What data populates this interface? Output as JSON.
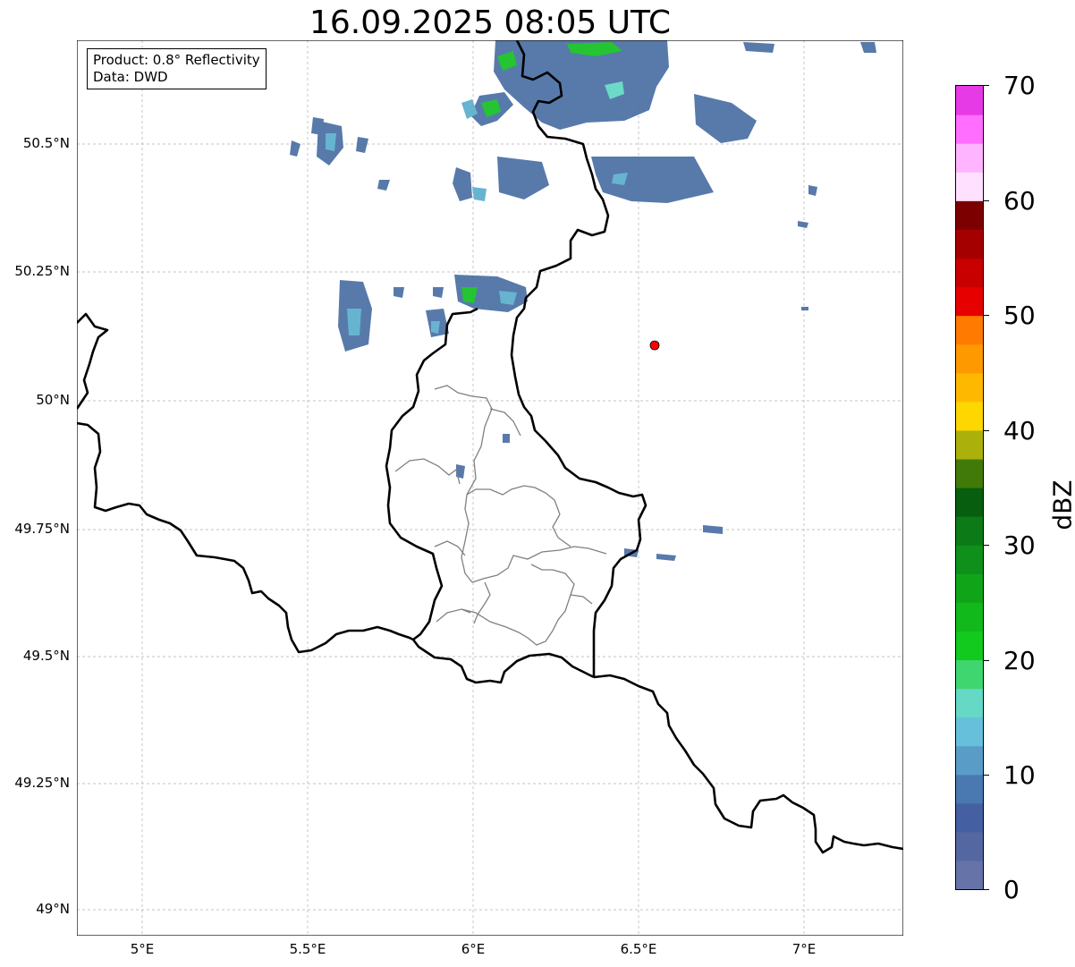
{
  "title": "16.09.2025 08:05 UTC",
  "info_box": {
    "product": "Product: 0.8° Reflectivity",
    "data": "Data: DWD"
  },
  "map": {
    "lon_range": [
      4.8,
      7.3
    ],
    "lat_range": [
      48.95,
      50.73
    ],
    "lat_ticks": [
      {
        "value": 50.5,
        "label": "50.5°N"
      },
      {
        "value": 50.25,
        "label": "50.25°N"
      },
      {
        "value": 50.0,
        "label": "50°N"
      },
      {
        "value": 49.75,
        "label": "49.75°N"
      },
      {
        "value": 49.5,
        "label": "49.5°N"
      },
      {
        "value": 49.25,
        "label": "49.25°N"
      },
      {
        "value": 49.0,
        "label": "49°N"
      }
    ],
    "lon_ticks": [
      {
        "value": 5.0,
        "label": "5°E"
      },
      {
        "value": 5.5,
        "label": "5.5°E"
      },
      {
        "value": 6.0,
        "label": "6°E"
      },
      {
        "value": 6.5,
        "label": "6.5°E"
      },
      {
        "value": 7.0,
        "label": "7°E"
      }
    ],
    "grid": true,
    "radar_site": {
      "lon": 6.55,
      "lat": 50.11,
      "color": "#ff0000"
    }
  },
  "colorbar": {
    "label": "dBZ",
    "min": 0,
    "max": 70,
    "ticks": [
      {
        "value": 70,
        "label": "70"
      },
      {
        "value": 60,
        "label": "60"
      },
      {
        "value": 50,
        "label": "50"
      },
      {
        "value": 40,
        "label": "40"
      },
      {
        "value": 30,
        "label": "30"
      },
      {
        "value": 20,
        "label": "20"
      },
      {
        "value": 10,
        "label": "10"
      },
      {
        "value": 0,
        "label": "0"
      }
    ],
    "colors": [
      "#6573a8",
      "#5567a0",
      "#4460a2",
      "#4a78b0",
      "#5a9cc8",
      "#66c0dc",
      "#66d8c6",
      "#3fd670",
      "#12c91e",
      "#12b91b",
      "#10a519",
      "#0e901a",
      "#0c7a16",
      "#075e0e",
      "#427a0a",
      "#acb00a",
      "#fed700",
      "#ffb800",
      "#ff9900",
      "#ff7a00",
      "#e60000",
      "#c80000",
      "#a50000",
      "#7d0000",
      "#ffe1ff",
      "#ffb4ff",
      "#ff6eff",
      "#e63ae6"
    ]
  }
}
